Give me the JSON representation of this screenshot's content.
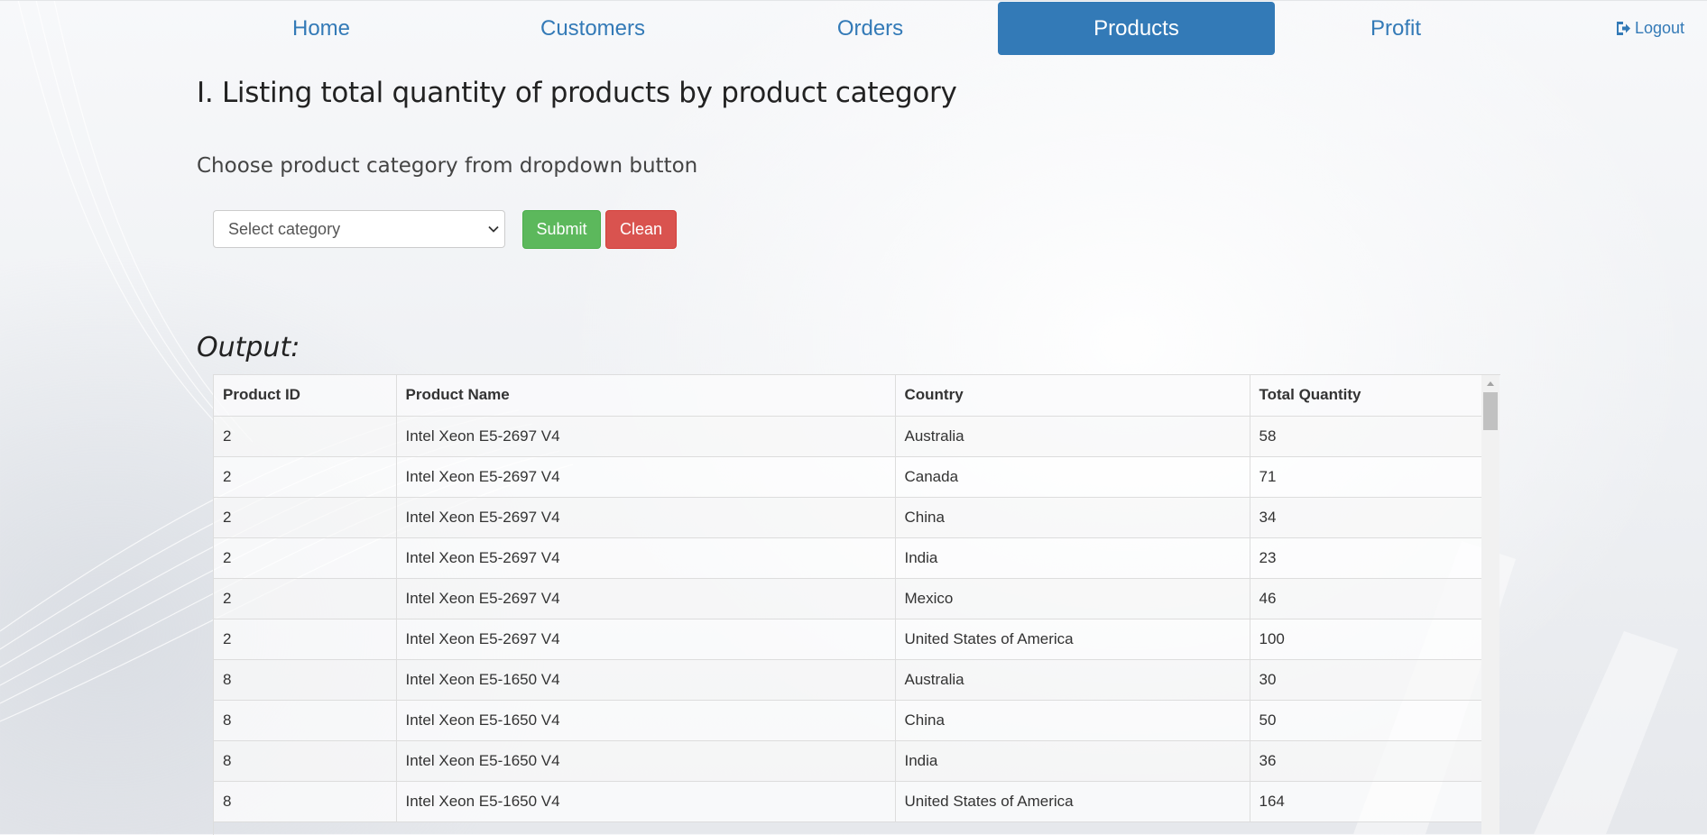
{
  "nav": {
    "items": [
      {
        "label": "Home"
      },
      {
        "label": "Customers"
      },
      {
        "label": "Orders"
      },
      {
        "label": "Products"
      },
      {
        "label": "Profit"
      }
    ],
    "active": "Products",
    "logout_label": "Logout",
    "logout_icon": "sign-out-icon",
    "accent_color": "#337ab7"
  },
  "page": {
    "title": "I. Listing total quantity of products by product category",
    "instruction": "Choose product category from dropdown button"
  },
  "form": {
    "category_select": {
      "selected": "Select category"
    },
    "submit_label": "Submit",
    "submit_color": "#5cb85c",
    "clean_label": "Clean",
    "clean_color": "#d9534f"
  },
  "output": {
    "label": "Output:",
    "columns": [
      "Product ID",
      "Product Name",
      "Country",
      "Total Quantity"
    ],
    "rows": [
      [
        "2",
        "Intel Xeon E5-2697 V4",
        "Australia",
        "58"
      ],
      [
        "2",
        "Intel Xeon E5-2697 V4",
        "Canada",
        "71"
      ],
      [
        "2",
        "Intel Xeon E5-2697 V4",
        "China",
        "34"
      ],
      [
        "2",
        "Intel Xeon E5-2697 V4",
        "India",
        "23"
      ],
      [
        "2",
        "Intel Xeon E5-2697 V4",
        "Mexico",
        "46"
      ],
      [
        "2",
        "Intel Xeon E5-2697 V4",
        "United States of America",
        "100"
      ],
      [
        "8",
        "Intel Xeon E5-1650 V4",
        "Australia",
        "30"
      ],
      [
        "8",
        "Intel Xeon E5-1650 V4",
        "China",
        "50"
      ],
      [
        "8",
        "Intel Xeon E5-1650 V4",
        "India",
        "36"
      ],
      [
        "8",
        "Intel Xeon E5-1650 V4",
        "United States of America",
        "164"
      ]
    ]
  }
}
